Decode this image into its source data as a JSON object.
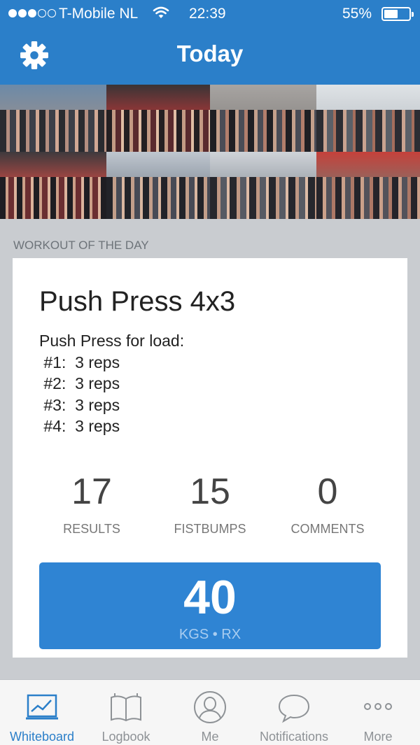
{
  "status_bar": {
    "carrier": "T-Mobile NL",
    "time": "22:39",
    "battery_percent": "55%",
    "battery_level": 0.55,
    "signal_bars": 3,
    "signal_total": 5
  },
  "nav": {
    "title": "Today",
    "settings_icon": "gear-icon"
  },
  "section": {
    "label": "WORKOUT OF THE DAY"
  },
  "workout": {
    "title": "Push Press 4x3",
    "description_lines": [
      "Push Press for load:",
      " #1:  3 reps",
      " #2:  3 reps",
      " #3:  3 reps",
      " #4:  3 reps"
    ],
    "stats": [
      {
        "value": "17",
        "label": "RESULTS"
      },
      {
        "value": "15",
        "label": "FISTBUMPS"
      },
      {
        "value": "0",
        "label": "COMMENTS"
      }
    ],
    "result": {
      "value": "40",
      "subtitle": "KGS • RX"
    }
  },
  "tabs": [
    {
      "label": "Whiteboard",
      "icon": "whiteboard-icon",
      "active": true
    },
    {
      "label": "Logbook",
      "icon": "book-icon",
      "active": false
    },
    {
      "label": "Me",
      "icon": "person-icon",
      "active": false
    },
    {
      "label": "Notifications",
      "icon": "speech-bubble-icon",
      "active": false
    },
    {
      "label": "More",
      "icon": "more-dots-icon",
      "active": false
    }
  ],
  "colors": {
    "primary": "#2b7fc9",
    "button": "#2f84d3",
    "tab_inactive": "#8e9296",
    "background": "#c9ccd0"
  }
}
